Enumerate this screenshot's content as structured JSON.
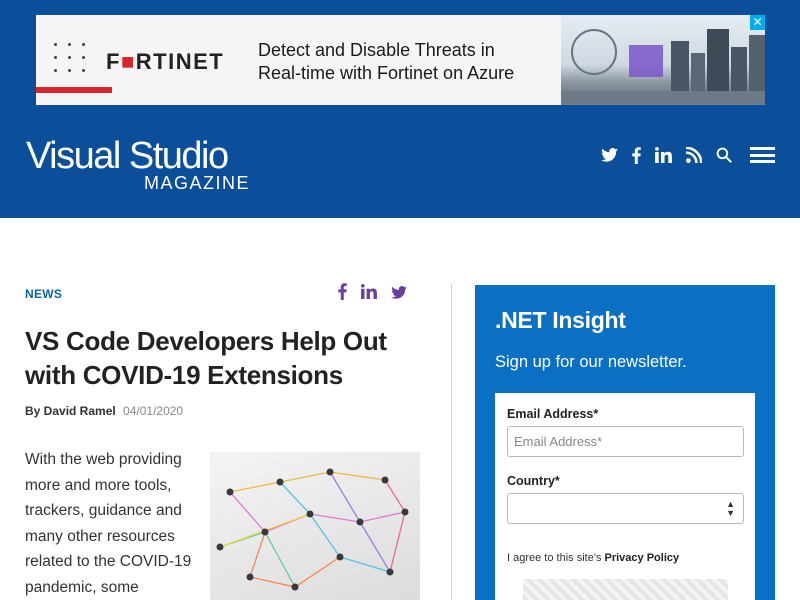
{
  "ad": {
    "brand": "F■RTINET",
    "headline_line1": "Detect and Disable Threats in",
    "headline_line2": "Real-time with Fortinet on Azure",
    "close": "✕"
  },
  "header": {
    "logo_main": "Visual Studio",
    "logo_sub": "MAGAZINE",
    "icons": [
      "twitter-icon",
      "facebook-icon",
      "linkedin-icon",
      "rss-icon",
      "search-icon",
      "menu-icon"
    ]
  },
  "article": {
    "category": "NEWS",
    "title": "VS Code Developers Help Out with COVID-19 Extensions",
    "author": "By David Ramel",
    "date": "04/01/2020",
    "body": "With the web providing more and more tools, trackers, guidance and many other resources related to the COVID-19 pandemic, some"
  },
  "sidebar": {
    "title": ".NET Insight",
    "subtitle": "Sign up for our newsletter.",
    "email_label": "Email Address*",
    "email_placeholder": "Email Address*",
    "country_label": "Country*",
    "country_value": "",
    "agree_text": "I agree to this site's",
    "privacy_link": "Privacy Policy"
  },
  "colors": {
    "header_blue": "#0b4f9b",
    "sidebar_blue": "#0a70c4",
    "category_blue": "#0b64a8",
    "share_purple": "#6b3fa0",
    "fortinet_red": "#d9262c"
  }
}
